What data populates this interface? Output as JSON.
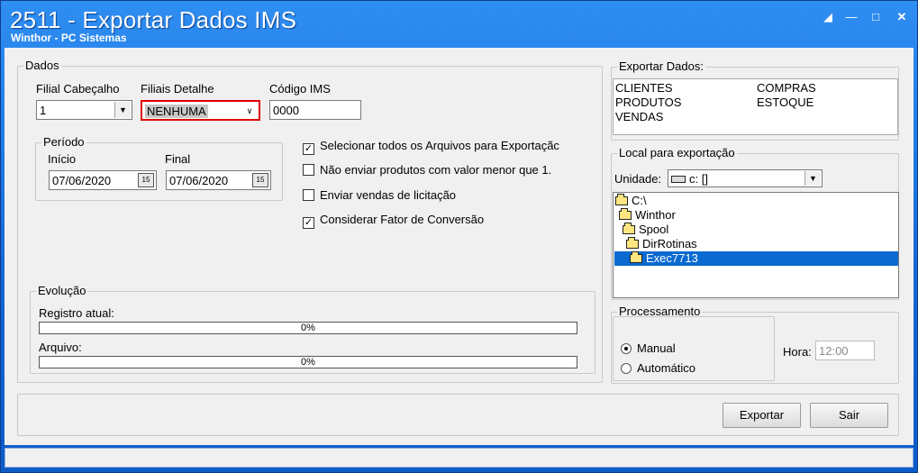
{
  "window": {
    "title": "2511 - Exportar Dados IMS",
    "subtitle": "Winthor - PC Sistemas",
    "controls": [
      "restore-icon",
      "minimize-icon",
      "maximize-icon",
      "close-icon"
    ]
  },
  "dados": {
    "group_label": "Dados",
    "filial_cabecalho": {
      "label": "Filial Cabeçalho",
      "value": "1"
    },
    "filiais_detalhe": {
      "label": "Filiais Detalhe",
      "value": "NENHUMA"
    },
    "codigo_ims": {
      "label": "Código IMS",
      "value": "0000"
    },
    "periodo": {
      "group_label": "Período",
      "inicio_label": "Início",
      "inicio_value": "07/06/2020",
      "final_label": "Final",
      "final_value": "07/06/2020",
      "calendar_glyph": "15"
    },
    "options": [
      {
        "label": "Selecionar todos os Arquivos para Exportaçãc",
        "checked": true
      },
      {
        "label": "Não enviar produtos com valor menor que 1.",
        "checked": false
      },
      {
        "label": "Enviar vendas de licitação",
        "checked": false
      },
      {
        "label": "Considerar Fator de Conversão",
        "checked": true
      }
    ],
    "evolucao": {
      "group_label": "Evolução",
      "registro_label": "Registro atual:",
      "registro_progress": "0%",
      "arquivo_label": "Arquivo:",
      "arquivo_progress": "0%"
    }
  },
  "exportar_dados": {
    "group_label": "Exportar Dados:",
    "col1": [
      "CLIENTES",
      "PRODUTOS",
      "VENDAS"
    ],
    "col2": [
      "COMPRAS",
      "ESTOQUE"
    ]
  },
  "local": {
    "group_label": "Local para exportação",
    "unidade_label": "Unidade:",
    "unidade_value": "c: []",
    "tree": [
      "C:\\",
      "Winthor",
      "Spool",
      "DirRotinas",
      "Exec7713"
    ]
  },
  "processamento": {
    "group_label": "Processamento",
    "manual_label": "Manual",
    "automatico_label": "Automático",
    "selected": "Manual",
    "hora_label": "Hora:",
    "hora_value": "12:00"
  },
  "buttons": {
    "exportar": "Exportar",
    "sair": "Sair"
  },
  "colors": {
    "title_bar": "#1f7ae6",
    "selection": "#0a6ad0",
    "highlight_border": "#e00000"
  }
}
